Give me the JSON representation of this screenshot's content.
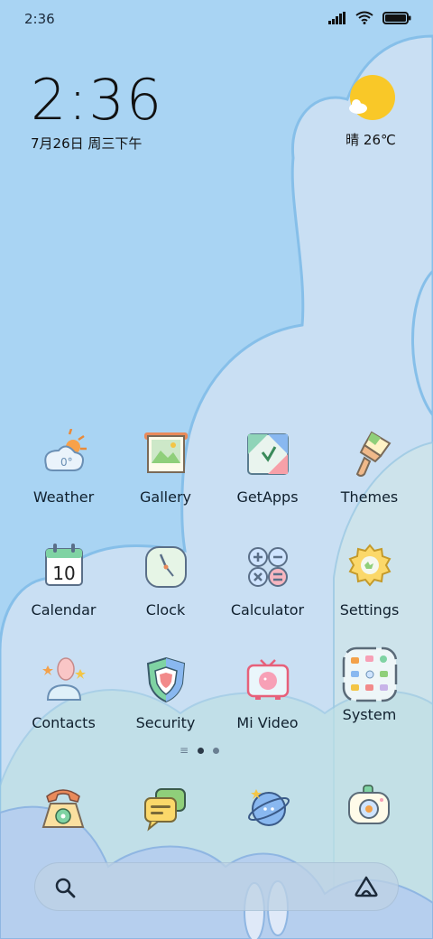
{
  "status_bar": {
    "time": "2:36"
  },
  "clock_widget": {
    "time": "2:36",
    "date": "7月26日 周三下午"
  },
  "weather_widget": {
    "text": "晴 26℃"
  },
  "apps": [
    {
      "label": "Weather",
      "icon": "weather-icon"
    },
    {
      "label": "Gallery",
      "icon": "gallery-icon"
    },
    {
      "label": "GetApps",
      "icon": "getapps-icon"
    },
    {
      "label": "Themes",
      "icon": "themes-icon"
    },
    {
      "label": "Calendar",
      "icon": "calendar-icon"
    },
    {
      "label": "Clock",
      "icon": "clock-icon"
    },
    {
      "label": "Calculator",
      "icon": "calculator-icon"
    },
    {
      "label": "Settings",
      "icon": "settings-icon"
    },
    {
      "label": "Contacts",
      "icon": "contacts-icon"
    },
    {
      "label": "Security",
      "icon": "security-icon"
    },
    {
      "label": "Mi Video",
      "icon": "mi-video-icon"
    },
    {
      "label": "System",
      "icon": "system-folder-icon"
    }
  ],
  "calendar_day": "10",
  "dock": [
    "phone-icon",
    "messages-icon",
    "browser-icon",
    "camera-icon"
  ],
  "page_indicator": {
    "pages": 2,
    "active": 1
  },
  "colors": {
    "sky": "#a9d4f3",
    "cloud": "#cfe1f3",
    "accent": "#f9c828"
  }
}
